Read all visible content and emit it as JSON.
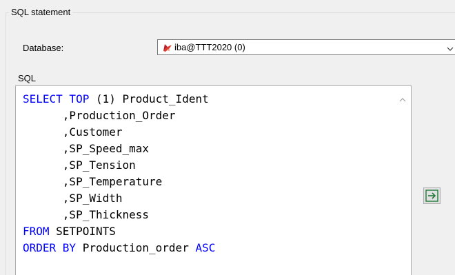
{
  "groupbox": {
    "title": "SQL statement"
  },
  "database": {
    "label": "Database:",
    "value": "iba@TTT2020 (0)",
    "icon": "database-connection-icon"
  },
  "sql": {
    "label": "SQL",
    "lines": [
      {
        "indent": "",
        "keyword": "SELECT TOP",
        "rest": " (1) Product_Ident"
      },
      {
        "indent": "      ",
        "keyword": "",
        "rest": ",Production_Order"
      },
      {
        "indent": "      ",
        "keyword": "",
        "rest": ",Customer"
      },
      {
        "indent": "      ",
        "keyword": "",
        "rest": ",SP_Speed_max"
      },
      {
        "indent": "      ",
        "keyword": "",
        "rest": ",SP_Tension"
      },
      {
        "indent": "      ",
        "keyword": "",
        "rest": ",SP_Temperature"
      },
      {
        "indent": "      ",
        "keyword": "",
        "rest": ",SP_Width"
      },
      {
        "indent": "      ",
        "keyword": "",
        "rest": ",SP_Thickness"
      },
      {
        "indent": "",
        "keyword": "FROM",
        "rest": " SETPOINTS"
      },
      {
        "indent": "",
        "keyword": "ORDER BY",
        "rest": " Production_order ",
        "keyword2": "ASC"
      }
    ]
  },
  "run_button": {
    "icon": "arrow-right-box-icon"
  },
  "colors": {
    "keyword": "#0000ff",
    "background": "#f0f0f0",
    "editor": "#ffffff"
  }
}
